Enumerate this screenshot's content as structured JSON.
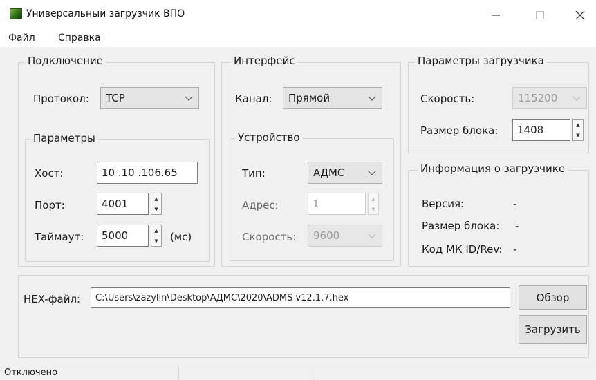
{
  "window": {
    "title": "Универсальный загрузчик ВПО",
    "minimize": "—",
    "maximize": "☐",
    "close": "✕"
  },
  "menu": {
    "file": "Файл",
    "help": "Справка"
  },
  "connection": {
    "title": "Подключение",
    "protocol_label": "Протокол:",
    "protocol_value": "TCP",
    "params": {
      "title": "Параметры",
      "host_label": "Хост:",
      "host_value": "10 .10 .106.65",
      "port_label": "Порт:",
      "port_value": "4001",
      "timeout_label": "Таймаут:",
      "timeout_value": "5000",
      "timeout_unit": "(мс)"
    }
  },
  "interface": {
    "title": "Интерфейс",
    "channel_label": "Канал:",
    "channel_value": "Прямой",
    "device": {
      "title": "Устройство",
      "type_label": "Тип:",
      "type_value": "АДМС",
      "address_label": "Адрес:",
      "address_value": "1",
      "speed_label": "Скорость:",
      "speed_value": "9600"
    }
  },
  "loader_params": {
    "title": "Параметры загрузчика",
    "speed_label": "Скорость:",
    "speed_value": "115200",
    "block_label": "Размер блока:",
    "block_value": "1408"
  },
  "loader_info": {
    "title": "Информация о загрузчике",
    "version_label": "Версия:",
    "version_value": "-",
    "block_label": "Размер блока:",
    "block_value": "-",
    "mk_label": "Код МК ID/Rev:",
    "mk_value": "-"
  },
  "hex": {
    "label": "HEX-файл:",
    "path": "C:\\Users\\zazylin\\Desktop\\АДМС\\2020\\ADMS v12.1.7.hex",
    "browse": "Обзор",
    "upload": "Загрузить"
  },
  "status": {
    "text": "Отключено"
  }
}
